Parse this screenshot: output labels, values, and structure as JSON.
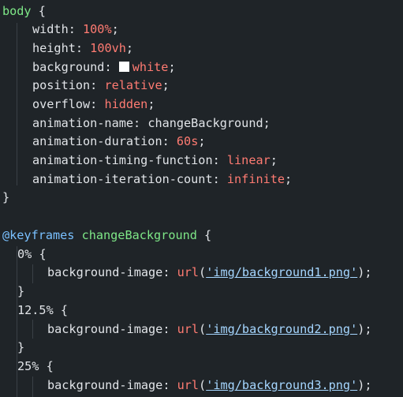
{
  "code": {
    "lines": [
      {
        "tokens": [
          {
            "t": "body",
            "c": "sel"
          },
          {
            "t": " {",
            "c": "punct"
          }
        ]
      },
      {
        "tokens": [
          {
            "t": "width",
            "c": "prop"
          },
          {
            "t": ": ",
            "c": "punct"
          },
          {
            "t": "100",
            "c": "num"
          },
          {
            "t": "%",
            "c": "num"
          },
          {
            "t": ";",
            "c": "punct"
          }
        ]
      },
      {
        "tokens": [
          {
            "t": "height",
            "c": "prop"
          },
          {
            "t": ": ",
            "c": "punct"
          },
          {
            "t": "100",
            "c": "num"
          },
          {
            "t": "vh",
            "c": "unit"
          },
          {
            "t": ";",
            "c": "punct"
          }
        ]
      },
      {
        "tokens": [
          {
            "t": "background",
            "c": "prop"
          },
          {
            "t": ": ",
            "c": "punct"
          },
          {
            "t": "",
            "c": "swatch"
          },
          {
            "t": "white",
            "c": "kw"
          },
          {
            "t": ";",
            "c": "punct"
          }
        ]
      },
      {
        "tokens": [
          {
            "t": "position",
            "c": "prop"
          },
          {
            "t": ": ",
            "c": "punct"
          },
          {
            "t": "relative",
            "c": "kw"
          },
          {
            "t": ";",
            "c": "punct"
          }
        ]
      },
      {
        "tokens": [
          {
            "t": "overflow",
            "c": "prop"
          },
          {
            "t": ": ",
            "c": "punct"
          },
          {
            "t": "hidden",
            "c": "kw"
          },
          {
            "t": ";",
            "c": "punct"
          }
        ]
      },
      {
        "tokens": [
          {
            "t": "animation-name",
            "c": "prop"
          },
          {
            "t": ": ",
            "c": "punct"
          },
          {
            "t": "changeBackground",
            "c": "plain"
          },
          {
            "t": ";",
            "c": "punct"
          }
        ]
      },
      {
        "tokens": [
          {
            "t": "animation-duration",
            "c": "prop"
          },
          {
            "t": ": ",
            "c": "punct"
          },
          {
            "t": "60",
            "c": "num"
          },
          {
            "t": "s",
            "c": "unit"
          },
          {
            "t": ";",
            "c": "punct"
          }
        ]
      },
      {
        "tokens": [
          {
            "t": "animation-timing-function",
            "c": "prop"
          },
          {
            "t": ": ",
            "c": "punct"
          },
          {
            "t": "linear",
            "c": "kw"
          },
          {
            "t": ";",
            "c": "punct"
          }
        ]
      },
      {
        "tokens": [
          {
            "t": "animation-iteration-count",
            "c": "prop"
          },
          {
            "t": ": ",
            "c": "punct"
          },
          {
            "t": "infinite",
            "c": "kw"
          },
          {
            "t": ";",
            "c": "punct"
          }
        ]
      },
      {
        "tokens": [
          {
            "t": "}",
            "c": "punct"
          }
        ]
      },
      {
        "tokens": []
      },
      {
        "tokens": [
          {
            "t": "@keyframes",
            "c": "at"
          },
          {
            "t": " ",
            "c": "plain"
          },
          {
            "t": "changeBackground",
            "c": "sel"
          },
          {
            "t": " {",
            "c": "punct"
          }
        ]
      },
      {
        "tokens": [
          {
            "t": "0%",
            "c": "pct"
          },
          {
            "t": " {",
            "c": "punct"
          }
        ]
      },
      {
        "tokens": [
          {
            "t": "background-image",
            "c": "prop"
          },
          {
            "t": ": ",
            "c": "punct"
          },
          {
            "t": "url",
            "c": "fn"
          },
          {
            "t": "(",
            "c": "punct"
          },
          {
            "t": "'img/background1.png'",
            "c": "str"
          },
          {
            "t": ");",
            "c": "punct"
          }
        ]
      },
      {
        "tokens": [
          {
            "t": "}",
            "c": "punct"
          }
        ]
      },
      {
        "tokens": [
          {
            "t": "12.5%",
            "c": "pct"
          },
          {
            "t": " {",
            "c": "punct"
          }
        ]
      },
      {
        "tokens": [
          {
            "t": "background-image",
            "c": "prop"
          },
          {
            "t": ": ",
            "c": "punct"
          },
          {
            "t": "url",
            "c": "fn"
          },
          {
            "t": "(",
            "c": "punct"
          },
          {
            "t": "'img/background2.png'",
            "c": "str"
          },
          {
            "t": ");",
            "c": "punct"
          }
        ]
      },
      {
        "tokens": [
          {
            "t": "}",
            "c": "punct"
          }
        ]
      },
      {
        "tokens": [
          {
            "t": "25%",
            "c": "pct"
          },
          {
            "t": " {",
            "c": "punct"
          }
        ]
      },
      {
        "tokens": [
          {
            "t": "background-image",
            "c": "prop"
          },
          {
            "t": ": ",
            "c": "punct"
          },
          {
            "t": "url",
            "c": "fn"
          },
          {
            "t": "(",
            "c": "punct"
          },
          {
            "t": "'img/background3.png'",
            "c": "str"
          },
          {
            "t": ");",
            "c": "punct"
          }
        ]
      }
    ]
  },
  "colors": {
    "background": "#1f2428",
    "selector": "#7ee787",
    "keyword": "#ff7b72",
    "at_rule": "#79c0ff",
    "string": "#a5d6ff"
  }
}
